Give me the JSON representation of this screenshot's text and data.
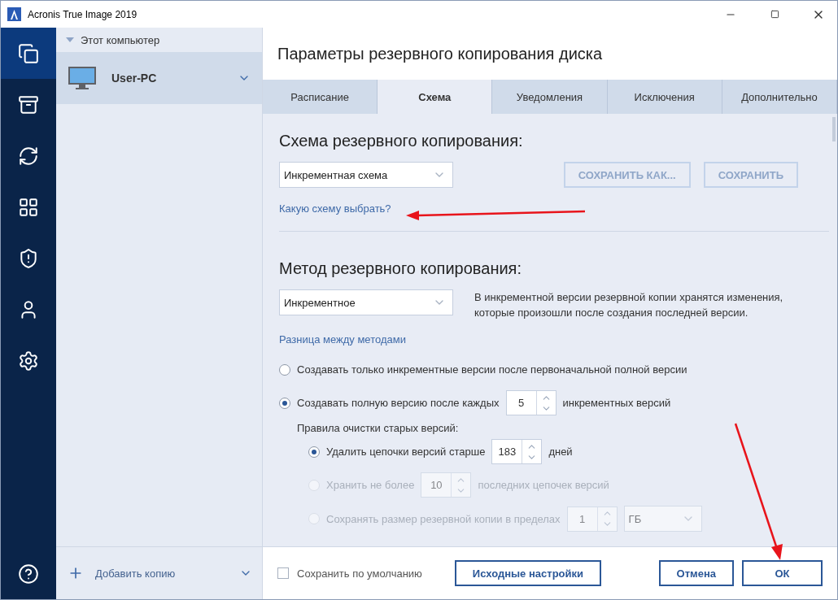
{
  "window": {
    "title": "Acronis True Image 2019"
  },
  "nav": {
    "items": [
      {
        "kind": "backup",
        "selected": true
      },
      {
        "kind": "archive",
        "selected": false
      },
      {
        "kind": "sync",
        "selected": false
      },
      {
        "kind": "tools",
        "selected": false
      },
      {
        "kind": "protection",
        "selected": false
      },
      {
        "kind": "account",
        "selected": false
      },
      {
        "kind": "settings",
        "selected": false
      }
    ],
    "help": {
      "kind": "help"
    }
  },
  "sidebar": {
    "group": {
      "label": "Этот компьютер",
      "expanded": true
    },
    "items": [
      {
        "label": "User-PC",
        "selected": true
      }
    ],
    "add_button": "Добавить копию"
  },
  "header": {
    "title": "Параметры резервного копирования диска"
  },
  "tabs": [
    {
      "label": "Расписание",
      "selected": false
    },
    {
      "label": "Схема",
      "selected": true
    },
    {
      "label": "Уведомления",
      "selected": false
    },
    {
      "label": "Исключения",
      "selected": false
    },
    {
      "label": "Дополнительно",
      "selected": false
    }
  ],
  "scheme": {
    "heading": "Схема резервного копирования:",
    "dropdown": "Инкрементная схема",
    "buttons": [
      {
        "label": "СОХРАНИТЬ КАК...",
        "disabled": true
      },
      {
        "label": "СОХРАНИТЬ",
        "disabled": true
      }
    ],
    "link": "Какую схему выбрать?"
  },
  "method": {
    "heading": "Метод резервного копирования:",
    "dropdown": "Инкрементное",
    "description": "В инкрементной версии резервной копии хранятся изменения, которые произошли после создания последней версии.",
    "link": "Разница между методами",
    "options": [
      {
        "label": "Создавать только инкрементные версии после первоначальной полной версии",
        "selected": false
      },
      {
        "label": "Создавать полную версию после каждых",
        "selected": true,
        "spinner": "5",
        "suffix": "инкрементных версий"
      }
    ],
    "cleanup": {
      "label": "Правила очистки старых версий:",
      "options": [
        {
          "label": "Удалить цепочки версий старше",
          "selected": true,
          "disabled": false,
          "spinner": "183",
          "suffix": "дней"
        },
        {
          "label": "Хранить не более",
          "selected": false,
          "disabled": true,
          "spinner": "10",
          "suffix": "последних цепочек версий"
        },
        {
          "label": "Сохранять размер резервной копии в пределах",
          "selected": false,
          "disabled": true,
          "spinner": "1",
          "unit": "ГБ"
        }
      ]
    }
  },
  "footer": {
    "checkbox": {
      "label": "Сохранить по умолчанию",
      "checked": false
    },
    "buttons": [
      "Исходные настройки",
      "Отмена",
      "ОК"
    ]
  }
}
